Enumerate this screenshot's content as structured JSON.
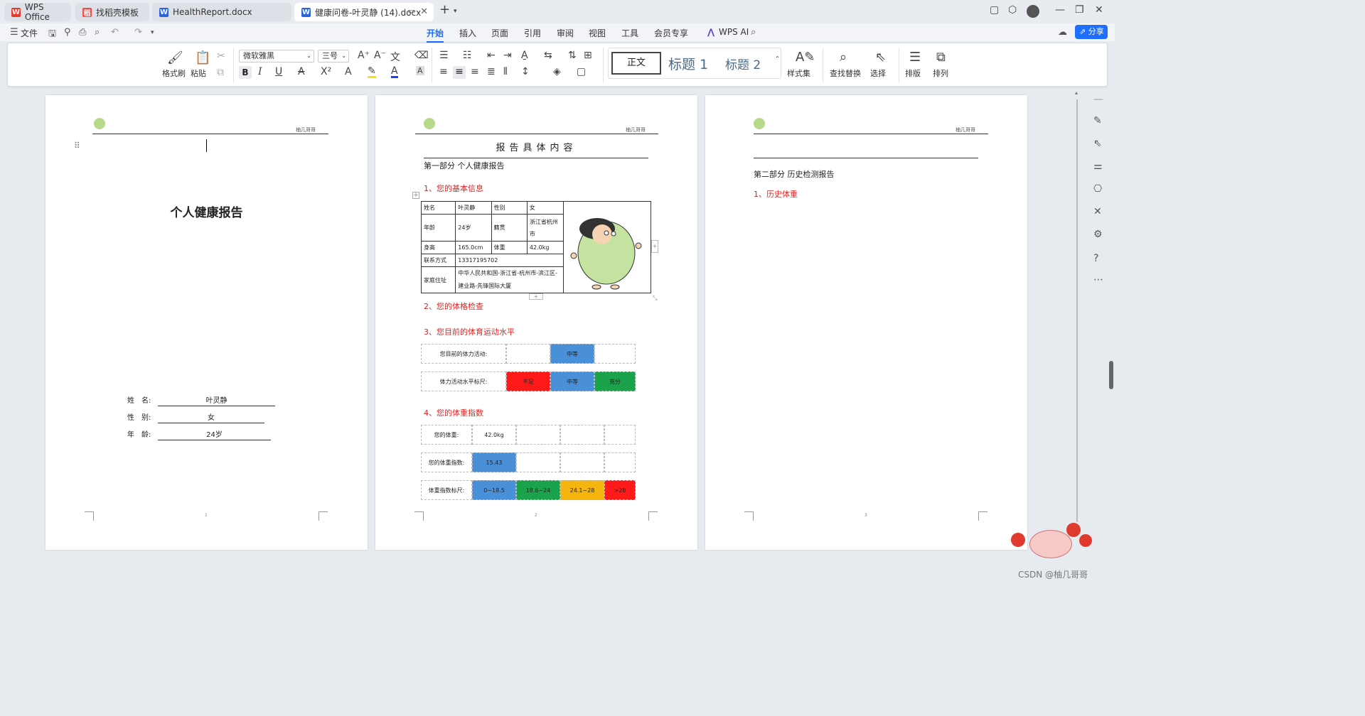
{
  "tabs": [
    {
      "label": "WPS Office",
      "icon": "wps-logo"
    },
    {
      "label": "找稻壳模板",
      "icon": "docer-icon"
    },
    {
      "label": "HealthReport.docx",
      "icon": "word-doc-icon"
    },
    {
      "label": "健康问卷-叶灵静 (14).docx",
      "icon": "word-doc-icon",
      "active": true
    }
  ],
  "menu": {
    "file": "文件",
    "items": [
      "开始",
      "插入",
      "页面",
      "引用",
      "审阅",
      "视图",
      "工具",
      "会员专享"
    ],
    "active": "开始",
    "wps_ai": "WPS AI",
    "share": "分享"
  },
  "ribbon": {
    "format_painter": "格式刷",
    "paste": "粘贴",
    "font_name": "微软雅黑",
    "font_size": "三号",
    "style_normal": "正文",
    "style_h1": "标题 1",
    "style_h2": "标题 2",
    "style_set": "样式集",
    "find_replace": "查找替换",
    "select": "选择",
    "layout": "排版",
    "arrange": "排列",
    "bold": "B",
    "italic": "I",
    "underline": "U"
  },
  "header_right": "柚几哥哥",
  "page1": {
    "title": "个人健康报告",
    "fields": [
      {
        "label": "姓　名:",
        "value": "叶灵静"
      },
      {
        "label": "性　别:",
        "value": "女"
      },
      {
        "label": "年　龄:",
        "value": "24岁"
      }
    ],
    "page_number": "1"
  },
  "page2": {
    "title": "报告具体内容",
    "part1": "第一部分  个人健康报告",
    "sec1": "1、您的基本信息",
    "info": {
      "name_label": "姓名",
      "name": "叶灵静",
      "gender_label": "性别",
      "gender": "女",
      "age_label": "年龄",
      "age": "24岁",
      "origin_label": "籍贯",
      "origin": "浙江省杭州市",
      "height_label": "身高",
      "height": "165.0cm",
      "weight_label": "体重",
      "weight": "42.0kg",
      "contact_label": "联系方式",
      "contact": "13317195702",
      "address_label": "家庭住址",
      "address": "中华人民共和国-浙江省-杭州市-滨江区-建业路-先锋国际大厦"
    },
    "sec2": "2、您的体格检查",
    "sec3": "3、您目前的体育运动水平",
    "activity_label": "您目前的体力活动:",
    "activity_value": "中等",
    "activity_scale_label": "体力活动水平标尺:",
    "activity_scale": [
      "不足",
      "中等",
      "充分"
    ],
    "sec4": "4、您的体重指数",
    "weight_label": "您的体重:",
    "weight_value": "42.0kg",
    "bmi_label": "您的体重指数:",
    "bmi_value": "15.43",
    "bmi_scale_label": "体重指数标尺:",
    "bmi_scale": [
      "0~18.5",
      "18.6~24",
      "24.1~28",
      ">28"
    ],
    "page_number": "2"
  },
  "page3": {
    "part2": "第二部分  历史检测报告",
    "sec1": "1、历史体重",
    "page_number": "3"
  },
  "watermark": "CSDN @柚几哥哥",
  "colors": {
    "accent": "#1e6fff",
    "red": "#e02424",
    "blue": "#4a90d9",
    "green": "#1aa34a",
    "orange": "#f6b50e",
    "scale_red": "#ff1a1a"
  }
}
